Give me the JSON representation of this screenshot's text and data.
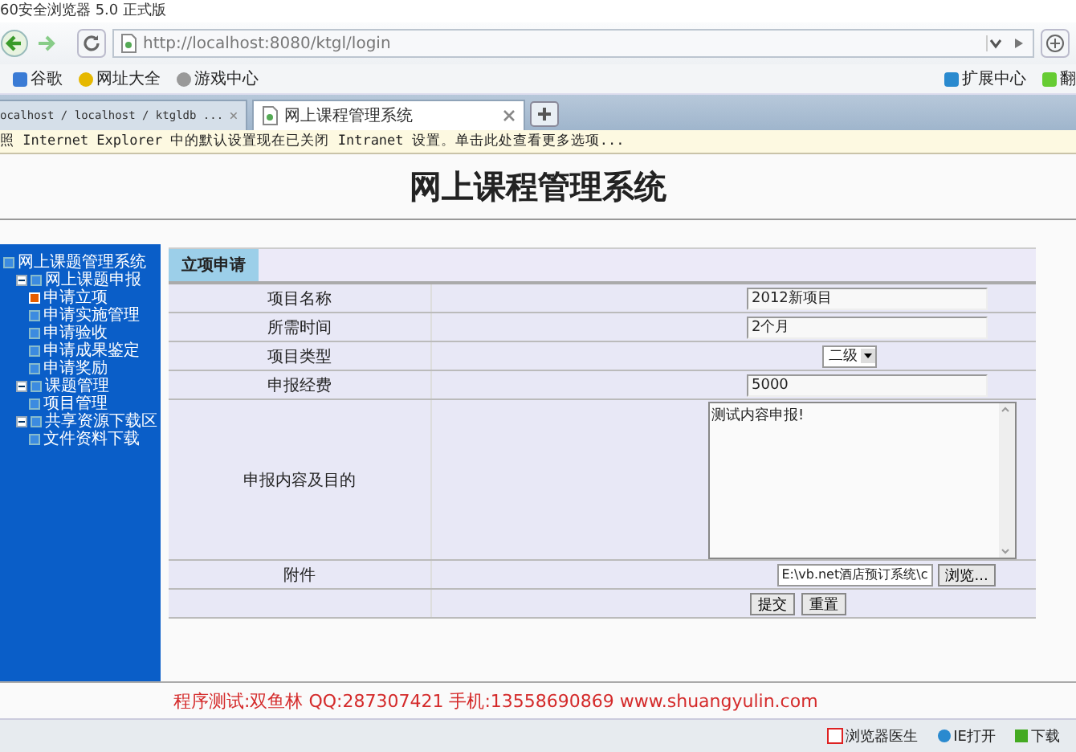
{
  "browser": {
    "title": "60安全浏览器 5.0 正式版",
    "address": "http://localhost:8080/ktgl/login",
    "bookmarks": [
      "谷歌",
      "网址大全",
      "游戏中心"
    ],
    "bookmarks_right": [
      "扩展中心",
      "翻"
    ],
    "tabs": [
      {
        "label": "ocalhost / localhost / ktgldb ...",
        "selected": false
      },
      {
        "label": "网上课程管理系统",
        "selected": true
      }
    ],
    "info_bar": "照 Internet Explorer 中的默认设置现在已关闭 Intranet 设置。单击此处查看更多选项..."
  },
  "page": {
    "title": "网上课程管理系统",
    "tree": [
      {
        "label": "网上课题管理系统",
        "selected": false,
        "children": [
          {
            "label": "网上课题申报",
            "selected": false,
            "expanded": true,
            "children": [
              {
                "label": "申请立项",
                "selected": true
              },
              {
                "label": "申请实施管理",
                "selected": false
              },
              {
                "label": "申请验收",
                "selected": false
              },
              {
                "label": "申请成果鉴定",
                "selected": false
              },
              {
                "label": "申请奖励",
                "selected": false
              }
            ]
          },
          {
            "label": "课题管理",
            "selected": false,
            "expanded": true,
            "children": [
              {
                "label": "项目管理",
                "selected": false
              }
            ]
          },
          {
            "label": "共享资源下载区",
            "selected": false,
            "expanded": true,
            "children": [
              {
                "label": "文件资料下载",
                "selected": false
              }
            ]
          }
        ]
      }
    ],
    "form": {
      "heading": "立项申请",
      "rows": [
        {
          "label": "项目名称",
          "kind": "text",
          "value": "2012新项目"
        },
        {
          "label": "所需时间",
          "kind": "text",
          "value": "2个月"
        },
        {
          "label": "项目类型",
          "kind": "select",
          "value": "二级"
        },
        {
          "label": "申报经费",
          "kind": "text",
          "value": "5000"
        },
        {
          "label": "申报内容及目的",
          "kind": "textarea",
          "value": "测试内容申报!"
        },
        {
          "label": "附件",
          "kind": "file",
          "value": "E:\\vb.net酒店预订系统\\c",
          "button": "浏览..."
        }
      ],
      "buttons": [
        "提交",
        "重置"
      ]
    },
    "footer": "程序测试:双鱼林 QQ:287307421 手机:13558690869 www.shuangyulin.com"
  },
  "status_bar": [
    "浏览器医生",
    "IE打开",
    "下载"
  ]
}
